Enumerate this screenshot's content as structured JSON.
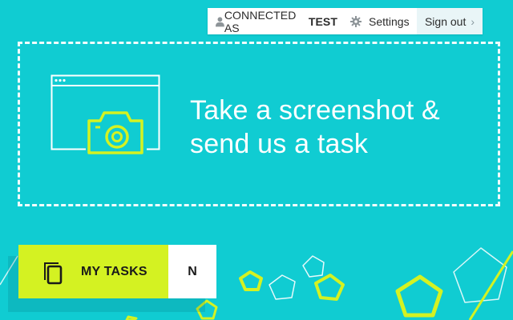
{
  "account": {
    "connected_prefix": "CONNECTED AS",
    "username": "TEST",
    "settings_label": "Settings",
    "signout_label": "Sign out",
    "chevron": "›",
    "icons": {
      "user": "user-icon",
      "settings": "gear-icon",
      "signout": "chevron-right-icon"
    }
  },
  "capture": {
    "line1": "Take a screenshot &",
    "line2": "send us a task",
    "icon": "camera-window-icon"
  },
  "tasks": {
    "label": "MY TASKS",
    "count": "N",
    "icon": "copy-icon"
  },
  "colors": {
    "background": "#10ccd2",
    "accent": "#d4f222",
    "white": "#ffffff"
  }
}
